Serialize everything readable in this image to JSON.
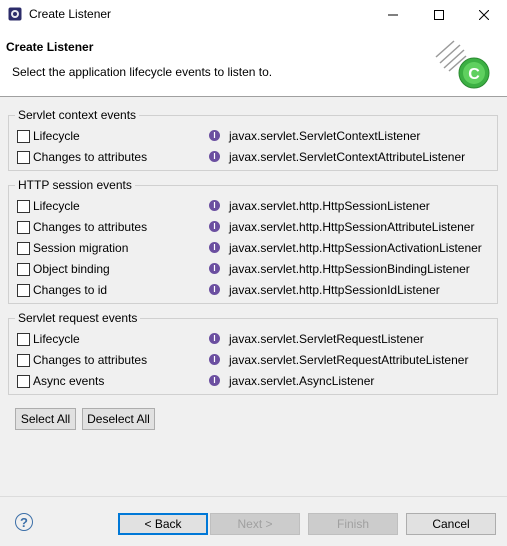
{
  "window": {
    "title": "Create Listener"
  },
  "header": {
    "title": "Create Listener",
    "description": "Select the application lifecycle events to listen to."
  },
  "groups": [
    {
      "label": "Servlet context events",
      "items": [
        {
          "label": "Lifecycle",
          "interface": "javax.servlet.ServletContextListener",
          "checked": false
        },
        {
          "label": "Changes to attributes",
          "interface": "javax.servlet.ServletContextAttributeListener",
          "checked": false
        }
      ]
    },
    {
      "label": "HTTP session events",
      "items": [
        {
          "label": "Lifecycle",
          "interface": "javax.servlet.http.HttpSessionListener",
          "checked": false
        },
        {
          "label": "Changes to attributes",
          "interface": "javax.servlet.http.HttpSessionAttributeListener",
          "checked": false
        },
        {
          "label": "Session migration",
          "interface": "javax.servlet.http.HttpSessionActivationListener",
          "checked": false
        },
        {
          "label": "Object binding",
          "interface": "javax.servlet.http.HttpSessionBindingListener",
          "checked": false
        },
        {
          "label": "Changes to id",
          "interface": "javax.servlet.http.HttpSessionIdListener",
          "checked": false
        }
      ]
    },
    {
      "label": "Servlet request events",
      "items": [
        {
          "label": "Lifecycle",
          "interface": "javax.servlet.ServletRequestListener",
          "checked": false
        },
        {
          "label": "Changes to attributes",
          "interface": "javax.servlet.ServletRequestAttributeListener",
          "checked": false
        },
        {
          "label": "Async events",
          "interface": "javax.servlet.AsyncListener",
          "checked": false
        }
      ]
    }
  ],
  "selection_buttons": {
    "select_all": "Select All",
    "deselect_all": "Deselect All"
  },
  "footer": {
    "back": "< Back",
    "next": "Next >",
    "finish": "Finish",
    "cancel": "Cancel"
  },
  "icons": {
    "help": "?",
    "interface_badge": "I"
  },
  "colors": {
    "interface_icon": "#6b4fa0",
    "default_button_border": "#0078d7",
    "logo_green": "#3cb043"
  }
}
